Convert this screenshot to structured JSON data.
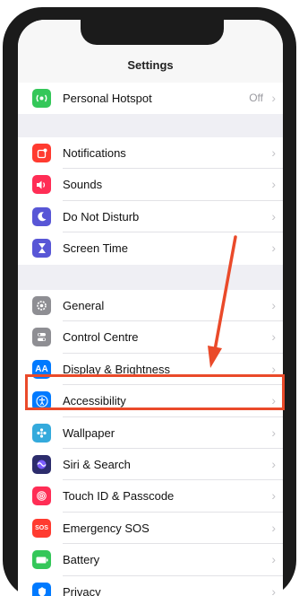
{
  "settings": {
    "title": "Settings",
    "groups": [
      {
        "items": [
          {
            "label": "Personal Hotspot",
            "detail": "Off",
            "icon": "hotspot-icon",
            "color": "#34c759"
          }
        ]
      },
      {
        "items": [
          {
            "label": "Notifications",
            "icon": "notifications-icon",
            "color": "#ff3b30"
          },
          {
            "label": "Sounds",
            "icon": "sounds-icon",
            "color": "#ff2d55"
          },
          {
            "label": "Do Not Disturb",
            "icon": "moon-icon",
            "color": "#5856d6"
          },
          {
            "label": "Screen Time",
            "icon": "hourglass-icon",
            "color": "#5856d6"
          }
        ]
      },
      {
        "items": [
          {
            "label": "General",
            "icon": "gear-icon",
            "color": "#8e8e93"
          },
          {
            "label": "Control Centre",
            "icon": "switches-icon",
            "color": "#8e8e93"
          },
          {
            "label": "Display & Brightness",
            "icon": "display-icon",
            "color": "#007aff"
          },
          {
            "label": "Accessibility",
            "icon": "accessibility-icon",
            "color": "#007aff"
          },
          {
            "label": "Wallpaper",
            "icon": "wallpaper-icon",
            "color": "#34aadc"
          },
          {
            "label": "Siri & Search",
            "icon": "siri-icon",
            "color": "#2c2c6c"
          },
          {
            "label": "Touch ID & Passcode",
            "icon": "fingerprint-icon",
            "color": "#ff2d55"
          },
          {
            "label": "Emergency SOS",
            "icon": "sos-icon",
            "color": "#ff3b30"
          },
          {
            "label": "Battery",
            "icon": "battery-icon",
            "color": "#34c759"
          },
          {
            "label": "Privacy",
            "icon": "privacy-icon",
            "color": "#007aff"
          }
        ]
      }
    ]
  },
  "annotation": {
    "color": "#ea4a2a"
  }
}
